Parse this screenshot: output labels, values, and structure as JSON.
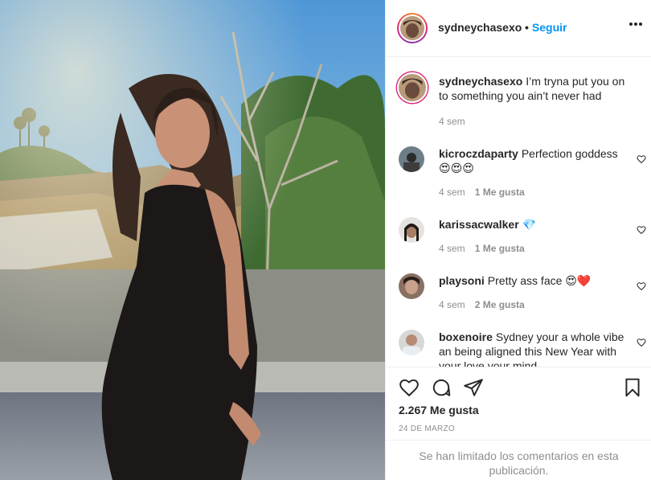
{
  "post": {
    "username": "sydneychasexo",
    "follow_label": "Seguir",
    "separator": "•"
  },
  "caption": {
    "username": "sydneychasexo",
    "text": "I’m tryna put you on to something you ain’t never had",
    "time": "4 sem"
  },
  "comments": [
    {
      "username": "kicroczdaparty",
      "text": "Perfection goddess 😍😍😍",
      "time": "4 sem",
      "likes": "1 Me gusta"
    },
    {
      "username": "karissacwalker",
      "text": "💎",
      "time": "4 sem",
      "likes": "1 Me gusta"
    },
    {
      "username": "playsoni",
      "text": "Pretty ass face 😍❤️",
      "time": "4 sem",
      "likes": "2 Me gusta"
    },
    {
      "username": "boxenoire",
      "text": "Sydney your a whole vibe an being aligned this New Year with your love your mind",
      "time": "",
      "likes": ""
    }
  ],
  "stats": {
    "likes": "2.267 Me gusta",
    "date": "24 DE MARZO"
  },
  "footer": {
    "limited_text": "Se han limitado los comentarios en esta publicación."
  },
  "icons": {
    "more": "more-options-icon",
    "like": "heart-icon",
    "comment": "comment-icon",
    "share": "share-icon",
    "save": "bookmark-icon"
  },
  "colors": {
    "accent": "#0095f6",
    "text": "#262626",
    "muted": "#8e8e8e",
    "border": "#efefef"
  }
}
